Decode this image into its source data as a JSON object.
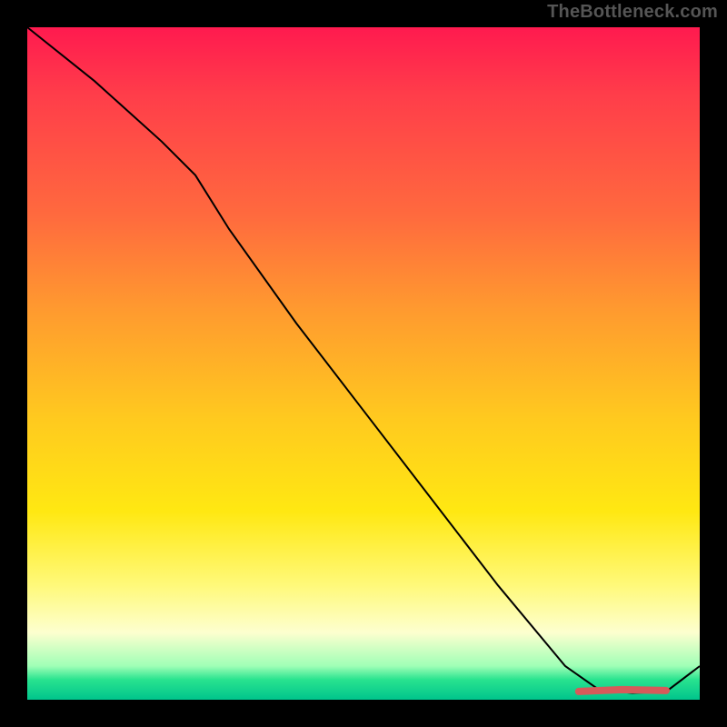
{
  "attribution": "TheBottleneck.com",
  "colors": {
    "page_bg": "#000000",
    "attribution_text": "#555555",
    "curve_stroke": "#000000",
    "marker_stroke": "#d65a5a",
    "gradient_stops": [
      {
        "pct": 0,
        "hex": "#ff1a4f"
      },
      {
        "pct": 10,
        "hex": "#ff3d4a"
      },
      {
        "pct": 28,
        "hex": "#ff6a3e"
      },
      {
        "pct": 42,
        "hex": "#ff9a2f"
      },
      {
        "pct": 58,
        "hex": "#ffc91f"
      },
      {
        "pct": 72,
        "hex": "#ffe812"
      },
      {
        "pct": 83,
        "hex": "#fff97a"
      },
      {
        "pct": 90,
        "hex": "#fdffcf"
      },
      {
        "pct": 95,
        "hex": "#9fffb6"
      },
      {
        "pct": 97,
        "hex": "#29e38f"
      },
      {
        "pct": 100,
        "hex": "#00c48c"
      }
    ]
  },
  "chart_data": {
    "type": "line",
    "note": "Axes have no visible tick labels; x and y are normalized fractions of the plot area (0..1 in each direction, y measured from bottom). Curve descends roughly linearly, flattens near the bottom ~x=0.85–0.95, then rises slightly at the right edge. A short muted-red marker segment sits on the flat valley.",
    "x": [
      0.0,
      0.1,
      0.2,
      0.25,
      0.3,
      0.4,
      0.5,
      0.6,
      0.7,
      0.8,
      0.85,
      0.9,
      0.95,
      1.0
    ],
    "y": [
      1.0,
      0.92,
      0.83,
      0.78,
      0.7,
      0.56,
      0.43,
      0.3,
      0.17,
      0.05,
      0.015,
      0.01,
      0.012,
      0.05
    ],
    "marker_segment": {
      "approx_x_range": [
        0.82,
        0.95
      ],
      "approx_y": 0.015,
      "label": "highlighted valley segment"
    },
    "title": "",
    "xlabel": "",
    "ylabel": "",
    "xlim": [
      0,
      1
    ],
    "ylim": [
      0,
      1
    ]
  }
}
